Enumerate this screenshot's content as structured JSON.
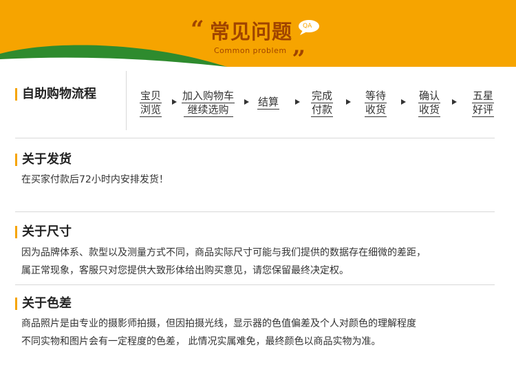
{
  "header": {
    "title": "常见问题",
    "subtitle": "Common problem",
    "open_quote": "“",
    "close_quote": "„",
    "badge": "QA",
    "colors": {
      "background": "#f6a400",
      "hill": "#2e8b2e",
      "title": "#a04400"
    }
  },
  "flow": {
    "heading": "自助购物流程",
    "steps": [
      {
        "line1": "宝贝",
        "line2": "浏览"
      },
      {
        "line1": "加入购物车",
        "line2": "继续选购"
      },
      {
        "line1": "结算",
        "line2": ""
      },
      {
        "line1": "完成",
        "line2": "付款"
      },
      {
        "line1": "等待",
        "line2": "收货"
      },
      {
        "line1": "确认",
        "line2": "收货"
      },
      {
        "line1": "五星",
        "line2": "好评"
      }
    ]
  },
  "sections": [
    {
      "heading": "关于发货",
      "lines": [
        "在买家付款后72小时内安排发货！"
      ]
    },
    {
      "heading": "关于尺寸",
      "lines": [
        "因为品牌体系、款型以及测量方式不同，商品实际尺寸可能与我们提供的数据存在细微的差距，",
        "属正常现象，客服只对您提供大致形体给出购买意见，请您保留最终决定权。"
      ]
    },
    {
      "heading": "关于色差",
      "lines": [
        "商品照片是由专业的摄影师拍摄，但因拍摄光线，显示器的色值偏差及个人对颜色的理解程度",
        "不同实物和图片会有一定程度的色差， 此情况实属难免，最终颜色以商品实物为准。"
      ]
    }
  ],
  "accent_color": "#f6a400"
}
